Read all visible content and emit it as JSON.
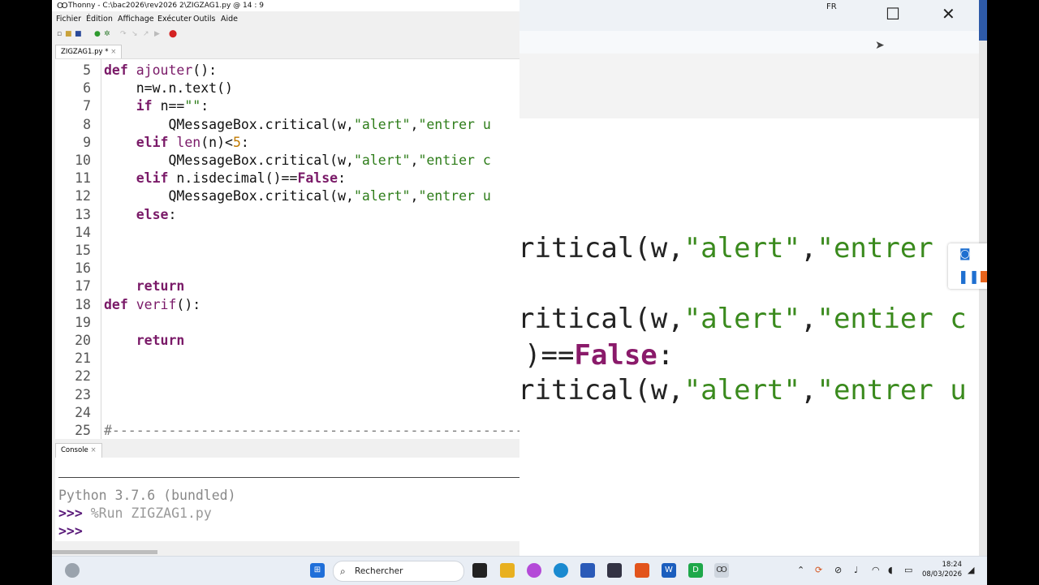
{
  "background_window": {
    "lang": "FR",
    "maximize_glyph": "☐",
    "close_glyph": "✕",
    "zoom_lines": [
      [
        {
          "t": "ritical(w,",
          "c": ""
        },
        {
          "t": "\"alert\"",
          "c": "s"
        },
        {
          "t": ",",
          "c": ""
        },
        {
          "t": "\"entrer ",
          "c": "s"
        }
      ],
      [
        {
          "t": "ritical(w,",
          "c": ""
        },
        {
          "t": "\"alert\"",
          "c": "s"
        },
        {
          "t": ",",
          "c": ""
        },
        {
          "t": "\"entier c",
          "c": "s"
        }
      ],
      [
        {
          "t": ")==",
          "c": ""
        },
        {
          "t": "False",
          "c": "k"
        },
        {
          "t": ":",
          "c": ""
        }
      ],
      [
        {
          "t": "ritical(w,",
          "c": ""
        },
        {
          "t": "\"alert\"",
          "c": "s"
        },
        {
          "t": ",",
          "c": ""
        },
        {
          "t": "\"entrer u",
          "c": "s"
        }
      ]
    ]
  },
  "thonny": {
    "title": "Thonny  -  C:\\bac2026\\rev2026 2\\ZIGZAG1.py  @  14 : 9",
    "menu": [
      "Fichier",
      "Édition",
      "Affichage",
      "Exécuter",
      "Outils",
      "Aide"
    ],
    "tab_label": "ZIGZAG1.py *",
    "console_tab": "Console",
    "lines": [
      {
        "n": "5",
        "tokens": [
          {
            "t": "def ",
            "c": "k"
          },
          {
            "t": "ajouter",
            "c": "b"
          },
          {
            "t": "():",
            "c": ""
          }
        ]
      },
      {
        "n": "6",
        "tokens": [
          {
            "t": "    n=w.n.text()",
            "c": ""
          }
        ]
      },
      {
        "n": "7",
        "tokens": [
          {
            "t": "    ",
            "c": ""
          },
          {
            "t": "if ",
            "c": "k"
          },
          {
            "t": "n==",
            "c": ""
          },
          {
            "t": "\"\"",
            "c": "s"
          },
          {
            "t": ":",
            "c": ""
          }
        ]
      },
      {
        "n": "8",
        "tokens": [
          {
            "t": "        QMessageBox.critical(w,",
            "c": ""
          },
          {
            "t": "\"alert\"",
            "c": "s"
          },
          {
            "t": ",",
            "c": ""
          },
          {
            "t": "\"entrer u",
            "c": "s"
          }
        ]
      },
      {
        "n": "9",
        "tokens": [
          {
            "t": "    ",
            "c": ""
          },
          {
            "t": "elif ",
            "c": "k"
          },
          {
            "t": "len",
            "c": "b"
          },
          {
            "t": "(n)<",
            "c": ""
          },
          {
            "t": "5",
            "c": "n"
          },
          {
            "t": ":",
            "c": ""
          }
        ]
      },
      {
        "n": "10",
        "tokens": [
          {
            "t": "        QMessageBox.critical(w,",
            "c": ""
          },
          {
            "t": "\"alert\"",
            "c": "s"
          },
          {
            "t": ",",
            "c": ""
          },
          {
            "t": "\"entier c",
            "c": "s"
          }
        ]
      },
      {
        "n": "11",
        "tokens": [
          {
            "t": "    ",
            "c": ""
          },
          {
            "t": "elif ",
            "c": "k"
          },
          {
            "t": "n.isdecimal()==",
            "c": ""
          },
          {
            "t": "False",
            "c": "k"
          },
          {
            "t": ":",
            "c": ""
          }
        ]
      },
      {
        "n": "12",
        "tokens": [
          {
            "t": "        QMessageBox.critical(w,",
            "c": ""
          },
          {
            "t": "\"alert\"",
            "c": "s"
          },
          {
            "t": ",",
            "c": ""
          },
          {
            "t": "\"entrer u",
            "c": "s"
          }
        ]
      },
      {
        "n": "13",
        "tokens": [
          {
            "t": "    ",
            "c": ""
          },
          {
            "t": "else",
            "c": "k"
          },
          {
            "t": ":",
            "c": ""
          }
        ]
      },
      {
        "n": "14",
        "tokens": []
      },
      {
        "n": "15",
        "tokens": []
      },
      {
        "n": "16",
        "tokens": []
      },
      {
        "n": "17",
        "tokens": [
          {
            "t": "    ",
            "c": ""
          },
          {
            "t": "return",
            "c": "k"
          }
        ]
      },
      {
        "n": "18",
        "tokens": [
          {
            "t": "def ",
            "c": "k"
          },
          {
            "t": "verif",
            "c": "b"
          },
          {
            "t": "():",
            "c": ""
          }
        ]
      },
      {
        "n": "19",
        "tokens": []
      },
      {
        "n": "20",
        "tokens": [
          {
            "t": "    ",
            "c": ""
          },
          {
            "t": "return",
            "c": "k"
          }
        ]
      },
      {
        "n": "21",
        "tokens": []
      },
      {
        "n": "22",
        "tokens": []
      },
      {
        "n": "23",
        "tokens": []
      },
      {
        "n": "24",
        "tokens": []
      },
      {
        "n": "25",
        "tokens": [
          {
            "t": "#----------------------------------------------------",
            "c": "c"
          }
        ]
      }
    ],
    "console": {
      "banner": "Python 3.7.6 (bundled)",
      "prompt": ">>>",
      "command": " %Run ZIGZAG1.py",
      "prompt2": ">>>"
    }
  },
  "taskbar": {
    "search_placeholder": "Rechercher",
    "time": "18:24",
    "date": "08/03/2026"
  }
}
